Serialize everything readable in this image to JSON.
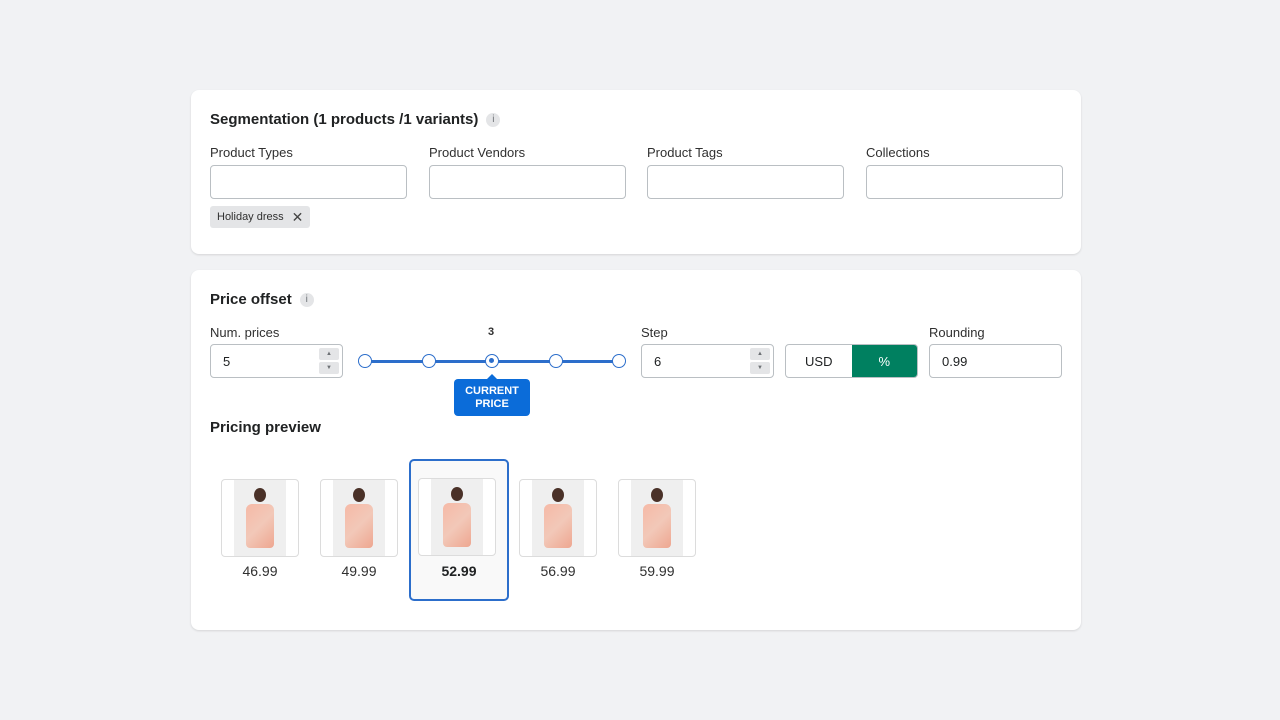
{
  "segmentation": {
    "title": "Segmentation (1 products /1 variants)",
    "info_icon": "i",
    "fields": [
      {
        "label": "Product Types",
        "value": ""
      },
      {
        "label": "Product Vendors",
        "value": ""
      },
      {
        "label": "Product Tags",
        "value": ""
      },
      {
        "label": "Collections",
        "value": ""
      }
    ],
    "tag": {
      "label": "Holiday dress",
      "remove_icon": "✕"
    }
  },
  "price_offset": {
    "title": "Price offset",
    "info_icon": "i",
    "num_prices": {
      "label": "Num. prices",
      "value": "5"
    },
    "slider": {
      "current_index_label": "3",
      "steps": 5,
      "current_step": 3,
      "bubble_line1": "CURRENT",
      "bubble_line2": "PRICE"
    },
    "step": {
      "label": "Step",
      "value": "6"
    },
    "unit_toggle": {
      "options": [
        "USD",
        "%"
      ],
      "selected": "%"
    },
    "rounding": {
      "label": "Rounding",
      "value": "0.99"
    },
    "spin_up": "▲",
    "spin_down": "▼"
  },
  "pricing_preview": {
    "title": "Pricing preview",
    "items": [
      {
        "price": "46.99",
        "selected": false
      },
      {
        "price": "49.99",
        "selected": false
      },
      {
        "price": "52.99",
        "selected": true
      },
      {
        "price": "56.99",
        "selected": false
      },
      {
        "price": "59.99",
        "selected": false
      }
    ]
  },
  "colors": {
    "accent": "#2c6ecb",
    "toggle_active": "#008060",
    "bubble": "#0b6cd9"
  }
}
